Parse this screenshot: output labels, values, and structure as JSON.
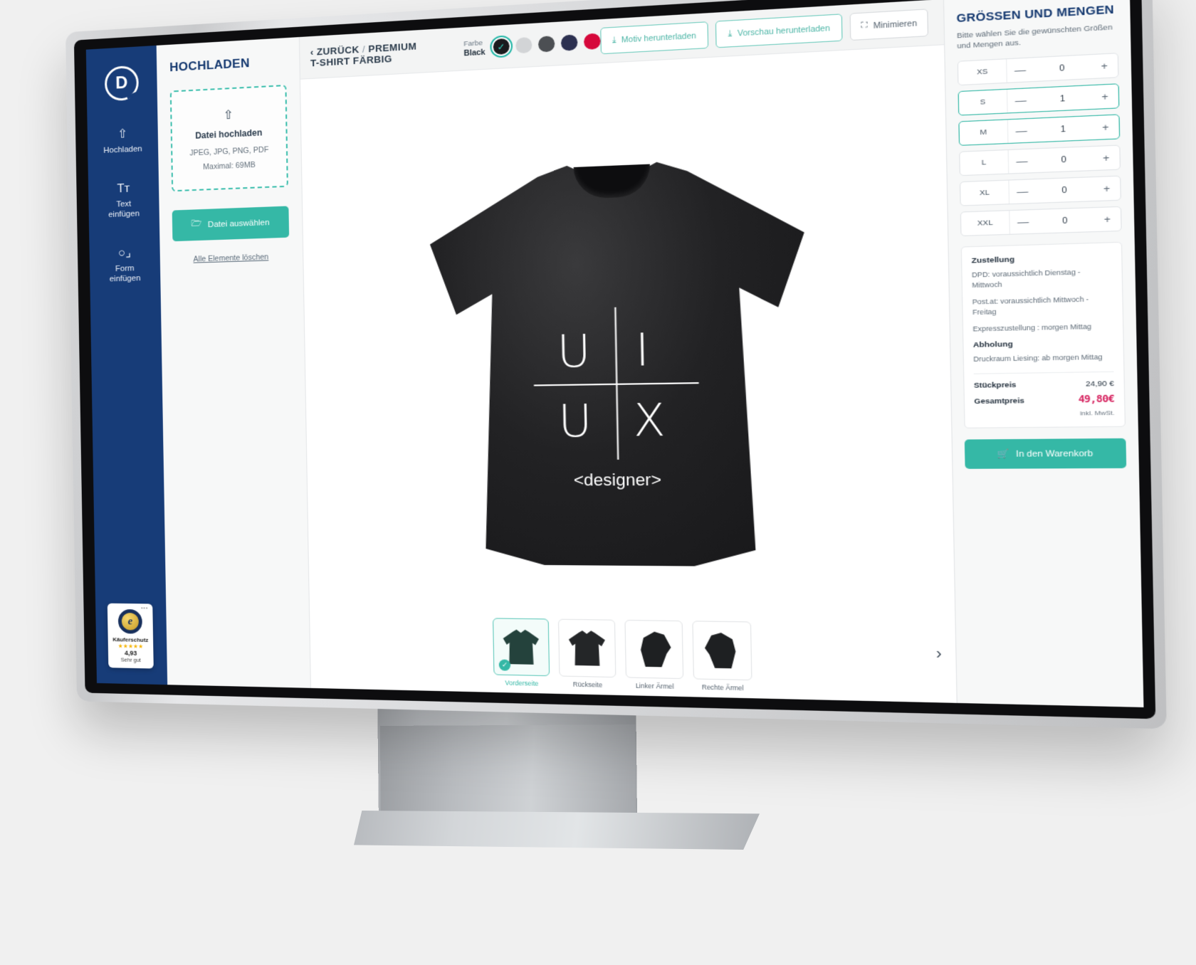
{
  "sidebar": {
    "logo": "logo-mark",
    "items": [
      {
        "icon": "upload-icon",
        "glyph": "⇧",
        "label": "Hochladen"
      },
      {
        "icon": "text-icon",
        "glyph": "Tᴛ",
        "label_1": "Text",
        "label_2": "einfügen"
      },
      {
        "icon": "shape-icon",
        "glyph": "○⌟",
        "label_1": "Form",
        "label_2": "einfügen"
      }
    ],
    "trustbadge": {
      "seal_letter": "e",
      "title": "Käuferschutz",
      "stars": "★★★★★",
      "score": "4,93",
      "rating_text": "Sehr gut",
      "menu_dots": "•••"
    }
  },
  "upload": {
    "title": "HOCHLADEN",
    "dropzone": {
      "icon": "upload-icon",
      "glyph": "⇧",
      "title": "Datei hochladen",
      "formats": "JPEG, JPG, PNG, PDF",
      "max": "Maximal: 69MB"
    },
    "select_button": "Datei auswählen",
    "select_button_icon": "folder-icon",
    "clear_link": "Alle Elemente löschen"
  },
  "topbar": {
    "back": "‹ ZURÜCK",
    "separator": "/",
    "product": "PREMIUM T-SHIRT FÄRBIG",
    "color_label": "Farbe",
    "color_value": "Black",
    "swatches": [
      {
        "name": "black",
        "hex": "#1b1b1d",
        "selected": true
      },
      {
        "name": "light-grey",
        "hex": "#d2d4d6",
        "selected": false
      },
      {
        "name": "dark-grey",
        "hex": "#4c4f53",
        "selected": false
      },
      {
        "name": "navy",
        "hex": "#2c3050",
        "selected": false
      },
      {
        "name": "red",
        "hex": "#d6083b",
        "selected": false
      }
    ],
    "check_glyph": "✓",
    "buttons": [
      {
        "name": "download-motif",
        "icon": "download-icon",
        "glyph": "⤓",
        "label": "Motiv herunterladen"
      },
      {
        "name": "download-preview",
        "icon": "download-icon",
        "glyph": "⤓",
        "label": "Vorschau herunterladen"
      },
      {
        "name": "minimize",
        "icon": "minimize-icon",
        "glyph": "⛶",
        "label": "Minimieren"
      }
    ]
  },
  "canvas": {
    "design": {
      "top_left": "U",
      "top_right": "I",
      "bottom_left": "U",
      "bottom_right": "X",
      "tagline": "<designer>"
    },
    "thumbnails": [
      {
        "label": "Vorderseite",
        "view": "front",
        "active": true
      },
      {
        "label": "Rückseite",
        "view": "back",
        "active": false
      },
      {
        "label": "Linker Ärmel",
        "view": "left-sleeve",
        "active": false
      },
      {
        "label": "Rechte Ärmel",
        "view": "right-sleeve",
        "active": false
      }
    ],
    "next_arrow": "›",
    "check_glyph": "✓"
  },
  "sizes": {
    "title": "GRÖSSEN UND MENGEN",
    "subtitle": "Bitte wählen Sie die gewünschten Größen und Mengen aus.",
    "minus": "—",
    "plus": "+",
    "rows": [
      {
        "size": "XS",
        "qty": "0",
        "selected": false
      },
      {
        "size": "S",
        "qty": "1",
        "selected": true
      },
      {
        "size": "M",
        "qty": "1",
        "selected": true
      },
      {
        "size": "L",
        "qty": "0",
        "selected": false
      },
      {
        "size": "XL",
        "qty": "0",
        "selected": false
      },
      {
        "size": "XXL",
        "qty": "0",
        "selected": false
      }
    ]
  },
  "delivery": {
    "heading_delivery": "Zustellung",
    "line_dpd": "DPD: voraussichtlich Dienstag - Mittwoch",
    "line_postat": "Post.at: voraussichtlich Mittwoch - Freitag",
    "line_express": "Expresszustellung : morgen Mittag",
    "heading_pickup": "Abholung",
    "line_pickup": "Druckraum Liesing: ab morgen Mittag",
    "unit_price_label": "Stückpreis",
    "unit_price_value": "24,90 €",
    "total_label": "Gesamtpreis",
    "total_value": "49,80€",
    "tax_note": "inkl. MwSt."
  },
  "cart": {
    "icon": "cart-icon",
    "glyph": "🛒",
    "label": "In den Warenkorb"
  },
  "colors": {
    "brand_navy": "#173c78",
    "accent_teal": "#35b8a6",
    "price_pink": "#d6215e"
  }
}
